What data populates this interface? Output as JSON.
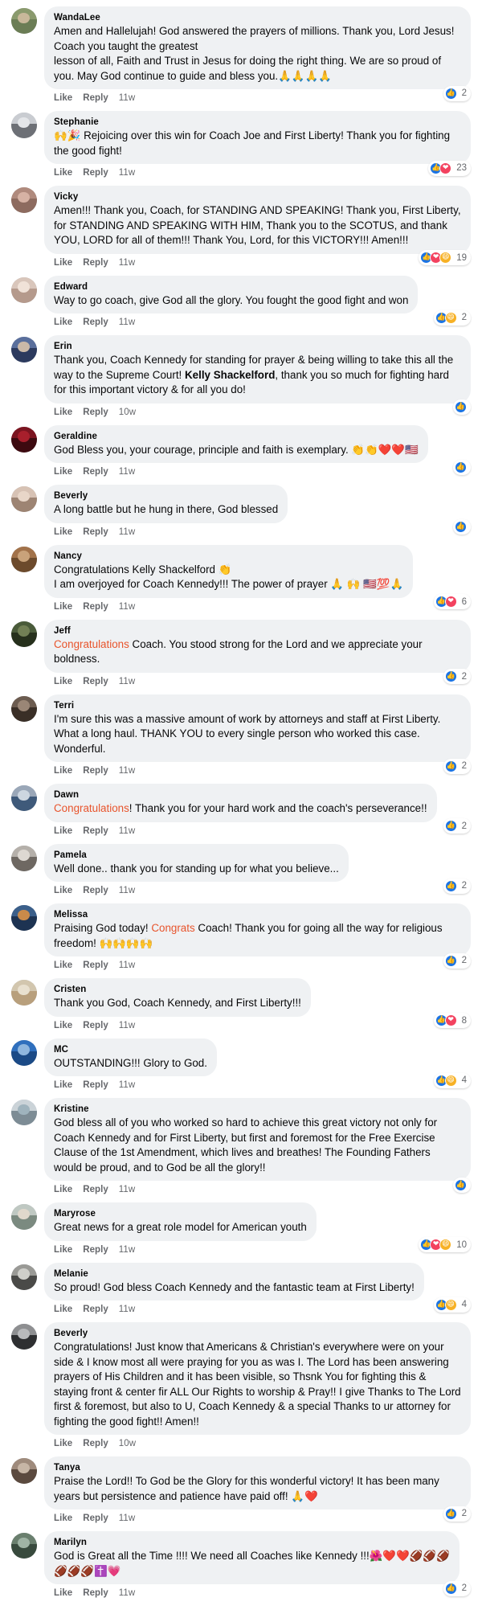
{
  "app": {
    "platform": "facebook-comments",
    "like_label": "Like",
    "reply_label": "Reply",
    "accent_like": "#1b74e4",
    "accent_love": "#f3425f",
    "accent_haha": "#f7b125",
    "highlight_color": "#e8542c",
    "bubble_bg": "#eff1f3"
  },
  "comments": [
    {
      "author": "WandaLee",
      "text": "Amen and Hallelujah! God answered the prayers of millions. Thank you, Lord Jesus! Coach you taught the greatest\nlesson of all, Faith and Trust in Jesus for doing the right thing. We are so proud of you. May God continue to guide and bless you.🙏🙏🙏🙏",
      "like": "Like",
      "reply": "Reply",
      "time": "11w",
      "reactions": [
        "like"
      ],
      "count": "2",
      "avatar": [
        "#8a9a6d",
        "#6b7d55",
        "#c8b89a"
      ]
    },
    {
      "author": "Stephanie",
      "text": "🙌🎉 Rejoicing over this win for Coach Joe and First Liberty! Thank you for fighting the good fight!",
      "like": "Like",
      "reply": "Reply",
      "time": "11w",
      "reactions": [
        "like",
        "love"
      ],
      "count": "23",
      "avatar": [
        "#c9ccd1",
        "#6d7076",
        "#e4e6e9"
      ]
    },
    {
      "author": "Vicky",
      "text": "Amen!!! Thank you, Coach, for STANDING AND SPEAKING! Thank you, First Liberty, for STANDING AND SPEAKING WITH HIM, Thank you to the SCOTUS, and thank YOU, LORD for all of them!!! Thank You, Lord, for this VICTORY!!! Amen!!!",
      "like": "Like",
      "reply": "Reply",
      "time": "11w",
      "reactions": [
        "like",
        "love",
        "haha"
      ],
      "count": "19",
      "avatar": [
        "#b08a7d",
        "#8d6b5f",
        "#d6b2a4"
      ]
    },
    {
      "author": "Edward",
      "text": "Way to go coach, give God all the glory. You fought the good fight and won",
      "like": "Like",
      "reply": "Reply",
      "time": "11w",
      "reactions": [
        "like",
        "haha"
      ],
      "count": "2",
      "avatar": [
        "#d9c6bb",
        "#b59a8c",
        "#f0e2d8"
      ]
    },
    {
      "author": "Erin",
      "text": "Thank you, Coach Kennedy for standing for prayer & being willing to take this all the way to the Supreme Court! §§Kelly Shackelford§§, thank you so much for fighting hard for this important victory & for all you do!",
      "like": "Like",
      "reply": "Reply",
      "time": "10w",
      "reactions": [
        "like"
      ],
      "count": "",
      "avatar": [
        "#5a6f9c",
        "#2c3a5e",
        "#cbb9a8"
      ]
    },
    {
      "author": "Geraldine",
      "text": "God Bless you, your courage, principle and faith is exemplary. 👏👏❤️❤️🇺🇸",
      "like": "Like",
      "reply": "Reply",
      "time": "11w",
      "reactions": [
        "like"
      ],
      "count": "",
      "avatar": [
        "#7b1420",
        "#3d0a10",
        "#a81f2c"
      ]
    },
    {
      "author": "Beverly",
      "text": "A long battle but he hung in there, God blessed",
      "like": "Like",
      "reply": "Reply",
      "time": "11w",
      "reactions": [
        "like"
      ],
      "count": "",
      "avatar": [
        "#d7c2b4",
        "#9d8473",
        "#e8d6c8"
      ]
    },
    {
      "author": "Nancy",
      "text": "Congratulations Kelly Shackelford 👏\nI am overjoyed for Coach Kennedy!!! The power of prayer 🙏 🙌 🇺🇸💯🙏",
      "like": "Like",
      "reply": "Reply",
      "time": "11w",
      "reactions": [
        "like",
        "love"
      ],
      "count": "6",
      "avatar": [
        "#a2724a",
        "#6c4a2c",
        "#c9a27a"
      ]
    },
    {
      "author": "Jeff",
      "text": "§§§Congratulations§§§ Coach. You stood strong for the Lord and we appreciate your boldness.",
      "like": "Like",
      "reply": "Reply",
      "time": "11w",
      "reactions": [
        "like"
      ],
      "count": "2",
      "avatar": [
        "#4a5b3a",
        "#26301c",
        "#728055"
      ]
    },
    {
      "author": "Terri",
      "text": "I'm sure this was a massive amount of work by attorneys and staff at First Liberty. What a long haul. THANK YOU to every single person who worked this case. Wonderful.",
      "like": "Like",
      "reply": "Reply",
      "time": "11w",
      "reactions": [
        "like"
      ],
      "count": "2",
      "avatar": [
        "#6c5c50",
        "#3a2f27",
        "#9a8676"
      ]
    },
    {
      "author": "Dawn",
      "text": "§§§Congratulations§§§! Thank you for your hard work and the coach's perseverance!!",
      "like": "Like",
      "reply": "Reply",
      "time": "11w",
      "reactions": [
        "like"
      ],
      "count": "2",
      "avatar": [
        "#9aa7b8",
        "#3f5a7a",
        "#cdd6e0"
      ]
    },
    {
      "author": "Pamela",
      "text": "Well done.. thank you for standing up for what you believe...",
      "like": "Like",
      "reply": "Reply",
      "time": "11w",
      "reactions": [
        "like"
      ],
      "count": "2",
      "avatar": [
        "#b5b0aa",
        "#6e6862",
        "#ddd8d2"
      ]
    },
    {
      "author": "Melissa",
      "text": "Praising God today! §§§Congrats§§§ Coach! Thank you for going all the way for religious freedom! 🙌🙌🙌🙌",
      "like": "Like",
      "reply": "Reply",
      "time": "11w",
      "reactions": [
        "like"
      ],
      "count": "2",
      "avatar": [
        "#3b5f8a",
        "#1d3352",
        "#c98a4a"
      ]
    },
    {
      "author": "Cristen",
      "text": "Thank you God, Coach Kennedy, and First Liberty!!!",
      "like": "Like",
      "reply": "Reply",
      "time": "11w",
      "reactions": [
        "like",
        "love"
      ],
      "count": "8",
      "avatar": [
        "#d2c6ae",
        "#b89f7c",
        "#e8e0cf"
      ]
    },
    {
      "author": "MC",
      "text": "OUTSTANDING!!! Glory to God.",
      "like": "Like",
      "reply": "Reply",
      "time": "11w",
      "reactions": [
        "like",
        "haha"
      ],
      "count": "4",
      "avatar": [
        "#2f6fbd",
        "#1b4a86",
        "#8fb6de"
      ]
    },
    {
      "author": "Kristine",
      "text": "God bless all of you who worked so hard to achieve this great victory not only for Coach Kennedy and for First Liberty, but first and foremost for the Free Exercise Clause of the 1st Amendment, which lives and breathes! The Founding Fathers would be proud, and to God be all the glory!!",
      "like": "Like",
      "reply": "Reply",
      "time": "11w",
      "reactions": [
        "like"
      ],
      "count": "",
      "avatar": [
        "#cbd3d8",
        "#7d8c95",
        "#9fb3bd"
      ]
    },
    {
      "author": "Maryrose",
      "text": "Great news for a great role model for American youth",
      "like": "Like",
      "reply": "Reply",
      "time": "11w",
      "reactions": [
        "like",
        "love",
        "haha"
      ],
      "count": "10",
      "avatar": [
        "#bfc8c2",
        "#7b8a80",
        "#e0d8cc"
      ]
    },
    {
      "author": "Melanie",
      "text": "So proud! God bless Coach Kennedy and the fantastic team at First Liberty!",
      "like": "Like",
      "reply": "Reply",
      "time": "11w",
      "reactions": [
        "like",
        "haha"
      ],
      "count": "4",
      "avatar": [
        "#9a9a96",
        "#4a4a48",
        "#cfcfca"
      ]
    },
    {
      "author": "Beverly",
      "text": "Congratulations! Just know that Americans & Christian's everywhere were on your side & I know most all were praying for you as was I. The Lord has been answering prayers of His Children and it has been visible, so Thsnk You for fighting this & staying front & center fir ALL Our Rights to worship & Pray!! I give Thanks to The Lord first & foremost, but also to U, Coach Kennedy & a special Thanks to ur attorney for fighting the good fight!! Amen!!",
      "like": "Like",
      "reply": "Reply",
      "time": "10w",
      "reactions": [],
      "count": "",
      "avatar": [
        "#8e8f91",
        "#2e2f31",
        "#b9babc"
      ]
    },
    {
      "author": "Tanya",
      "text": "Praise the Lord!! To God be the Glory for this wonderful victory! It has been many years but persistence and patience have paid off! 🙏❤️",
      "like": "Like",
      "reply": "Reply",
      "time": "11w",
      "reactions": [
        "like"
      ],
      "count": "2",
      "avatar": [
        "#9f8b7c",
        "#5b4a3f",
        "#c7b6a6"
      ]
    },
    {
      "author": "Marilyn",
      "text": "God is Great all the Time !!!! We need all Coaches like Kennedy !!!🌺❤️❤️🏈🏈🏈\n🏈🏈🏈✝️💗",
      "like": "Like",
      "reply": "Reply",
      "time": "11w",
      "reactions": [
        "like"
      ],
      "count": "2",
      "avatar": [
        "#6a7f6e",
        "#384a3d",
        "#9fb3a4"
      ]
    }
  ]
}
